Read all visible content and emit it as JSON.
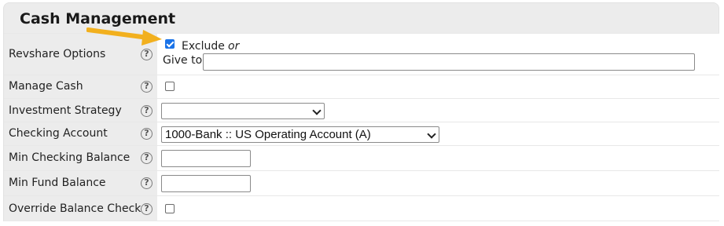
{
  "panel": {
    "title": "Cash Management"
  },
  "help_glyph": "?",
  "rows": {
    "revshare": {
      "label": "Revshare Options",
      "exclude_label": "Exclude",
      "or_label": "or",
      "give_to_label": "Give to",
      "give_to_value": "",
      "exclude_checked": true
    },
    "manage_cash": {
      "label": "Manage Cash",
      "checked": false
    },
    "investment_strategy": {
      "label": "Investment Strategy",
      "selected": ""
    },
    "checking_account": {
      "label": "Checking Account",
      "selected": "1000-Bank :: US Operating Account (A)"
    },
    "min_checking": {
      "label": "Min Checking Balance",
      "value": ""
    },
    "min_fund": {
      "label": "Min Fund Balance",
      "value": ""
    },
    "override_balance": {
      "label": "Override Balance Check",
      "checked": false
    }
  },
  "colors": {
    "arrow": "#f2b01e",
    "checkbox_checked": "#1a73e8",
    "label_bg": "#ececec"
  },
  "icons": {
    "help": "help-circle-icon",
    "arrow": "pointer-arrow-icon",
    "select": "chevron-down-icon"
  }
}
